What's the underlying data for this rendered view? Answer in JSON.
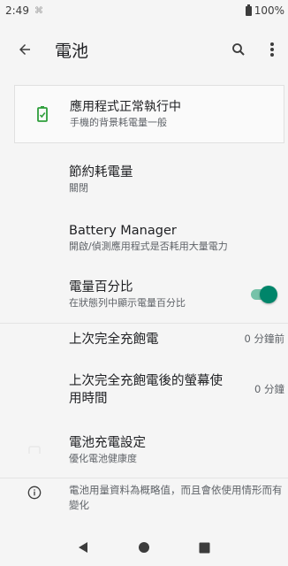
{
  "status_bar": {
    "time": "2:49",
    "notification_glyph": "⌘",
    "battery": "100%"
  },
  "app_bar": {
    "title": "電池",
    "back_icon": "arrow-back-icon",
    "search_icon": "search-icon",
    "more_icon": "more-vert-icon"
  },
  "banner": {
    "title": "應用程式正常執行中",
    "subtitle": "手機的背景耗電量一般",
    "icon": "battery-icon",
    "icon_color": "#2e9e3b"
  },
  "items": {
    "battery_saver": {
      "title": "節約耗電量",
      "subtitle": "關閉"
    },
    "battery_manager": {
      "title": "Battery Manager",
      "subtitle": "開啟/偵測應用程式是否耗用大量電力"
    },
    "battery_percentage": {
      "title": "電量百分比",
      "subtitle": "在狀態列中顯示電量百分比",
      "toggle_on": true
    },
    "last_full_charge": {
      "title": "上次完全充飽電",
      "value": "0 分鐘前"
    },
    "screen_usage": {
      "title": "上次完全充飽電後的螢幕使用時間",
      "value": "0 分鐘"
    },
    "charging_settings": {
      "title": "電池充電設定",
      "subtitle": "優化電池健康度"
    }
  },
  "footer_info": {
    "text": "電池用量資料為概略值，而且會依使用情形而有變化",
    "icon": "info-icon"
  },
  "nav_bar": {
    "back": "nav-back-icon",
    "home": "nav-home-icon",
    "recents": "nav-recents-icon"
  },
  "colors": {
    "accent": "#00856a",
    "accent_track": "#76c2a9",
    "banner_icon": "#2e9e3b"
  }
}
